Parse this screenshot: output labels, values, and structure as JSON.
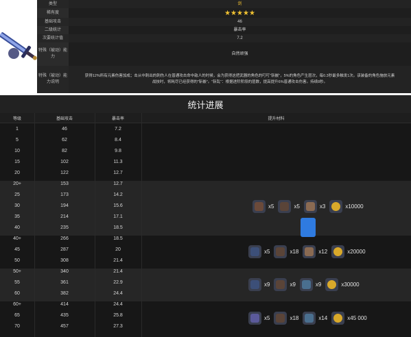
{
  "info": {
    "rows": [
      {
        "key": "类型",
        "value": "剑"
      },
      {
        "key": "稀有度",
        "value": "★★★★★"
      },
      {
        "key": "基础攻击",
        "value": "46"
      },
      {
        "key": "二级统计",
        "value": "暴击率"
      },
      {
        "key": "次要统计值",
        "value": "7.2"
      },
      {
        "key": "特殊（被动）能力",
        "value": "自然顽强"
      },
      {
        "key": "特殊（被动）能力说明",
        "value": "获得12%所有元素伤害加成；击从中刺出的刺伤人在普通攻击命中敌人的时候，会为获得这把武器的角色的叮叮\"斩嵌\"，5%的角色产生层次，每0.3秒最多触发1次。该装备的角色施放元素战技时，将耗尽已经获得的\"斩嵌\"。\"斩乱\"：根据进阶阶段的层数，提高提升6%普通攻击伤害。持续8秒。"
      }
    ]
  },
  "stats": {
    "title": "统计进展",
    "headers": {
      "level": "等级",
      "atk": "基础攻击",
      "crit": "暴击率",
      "materials": "提升材料"
    },
    "rows": [
      {
        "level": "1",
        "atk": "46",
        "crit": "7.2"
      },
      {
        "level": "5",
        "atk": "62",
        "crit": "8.4"
      },
      {
        "level": "10",
        "atk": "82",
        "crit": "9.8"
      },
      {
        "level": "15",
        "atk": "102",
        "crit": "11.3"
      },
      {
        "level": "20",
        "atk": "122",
        "crit": "12.7"
      },
      {
        "level": "20+",
        "atk": "153",
        "crit": "12.7"
      },
      {
        "level": "25",
        "atk": "173",
        "crit": "14.2"
      },
      {
        "level": "30",
        "atk": "194",
        "crit": "15.6"
      },
      {
        "level": "35",
        "atk": "214",
        "crit": "17.1"
      },
      {
        "level": "40",
        "atk": "235",
        "crit": "18.5"
      },
      {
        "level": "40+",
        "atk": "266",
        "crit": "18.5"
      },
      {
        "level": "45",
        "atk": "287",
        "crit": "20"
      },
      {
        "level": "50",
        "atk": "308",
        "crit": "21.4"
      },
      {
        "level": "50+",
        "atk": "340",
        "crit": "21.4"
      },
      {
        "level": "55",
        "atk": "361",
        "crit": "22.9"
      },
      {
        "level": "60",
        "atk": "382",
        "crit": "24.4"
      },
      {
        "level": "60+",
        "atk": "414",
        "crit": "24.4"
      },
      {
        "level": "65",
        "atk": "435",
        "crit": "25.8"
      },
      {
        "level": "70",
        "atk": "457",
        "crit": "27.3"
      }
    ],
    "ascensions": [
      {
        "items": [
          {
            "icon": "brown-scale-icon",
            "color": "#6b4a3a",
            "qty": "x5"
          },
          {
            "icon": "feather-icon",
            "color": "#5a4438",
            "qty": "x5"
          },
          {
            "icon": "shell-icon",
            "color": "#8a6a52",
            "qty": "x3"
          },
          {
            "icon": "mora-coin-icon",
            "color": "#d9a92a",
            "qty": "x10000"
          }
        ]
      },
      {
        "items": [
          {
            "icon": "blue-hook-icon",
            "color": "#3c4f78",
            "qty": "x5"
          },
          {
            "icon": "feather-icon",
            "color": "#5a4438",
            "qty": "x18"
          },
          {
            "icon": "shell-icon",
            "color": "#8a6a52",
            "qty": "x12"
          },
          {
            "icon": "mora-coin-icon",
            "color": "#d9a92a",
            "qty": "x20000"
          }
        ]
      },
      {
        "items": [
          {
            "icon": "blue-hook-icon",
            "color": "#3c4f78",
            "qty": "x9"
          },
          {
            "icon": "feather-icon",
            "color": "#5a4438",
            "qty": "x9"
          },
          {
            "icon": "blue-shell-icon",
            "color": "#4a6f8f",
            "qty": "x9"
          },
          {
            "icon": "mora-coin-icon",
            "color": "#d9a92a",
            "qty": "x30000"
          }
        ]
      },
      {
        "items": [
          {
            "icon": "violet-hook-icon",
            "color": "#5b5a9a",
            "qty": "x5"
          },
          {
            "icon": "feather-icon",
            "color": "#5a4438",
            "qty": "x18"
          },
          {
            "icon": "blue-shell-icon",
            "color": "#4a6f8f",
            "qty": "x14"
          },
          {
            "icon": "mora-coin-icon",
            "color": "#d9a92a",
            "qty": "x45 000"
          }
        ]
      }
    ]
  }
}
